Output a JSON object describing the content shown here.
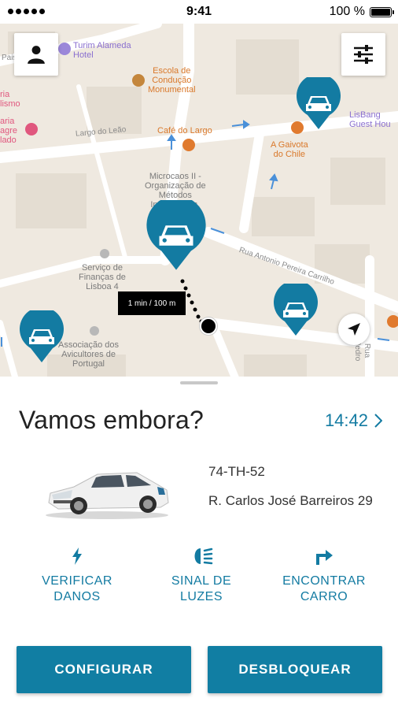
{
  "status_bar": {
    "time": "9:41",
    "battery": "100 %"
  },
  "map": {
    "labels": {
      "hotel": "Turim Alameda\nHotel",
      "school": "Escola de\nCondução\nMonumental",
      "street_leao": "Largo do Leão",
      "cafe": "Café do Largo",
      "gaivota": "A Gaivota\ndo Chile",
      "lisbang": "LisBang\nGuest Hou",
      "microcaos": "Microcaos II -\nOrganização de\nMétodos\nInformáticos,",
      "rua_antonio": "Rua Antonio Pereira Carrilho",
      "financas": "Serviço de\nFinanças de\nLisboa 4",
      "avicultores": "Associação dos\nAvicultores de\nPortugal",
      "left_edge_1": "ria\nlismo",
      "left_edge_2": "aria\nagre\nlado",
      "pais": "Pais",
      "right_edge": "Rua Pedro"
    },
    "eta_tooltip": "1 min / 100 m",
    "accent_color": "#137ba2"
  },
  "sheet": {
    "headline": "Vamos embora?",
    "time": "14:42",
    "plate": "74-TH-52",
    "address": "R. Carlos José Barreiros 29",
    "actions": [
      {
        "label": "VERIFICAR\nDANOS",
        "icon": "lightning-icon"
      },
      {
        "label": "SINAL DE\nLUZES",
        "icon": "headlight-icon"
      },
      {
        "label": "ENCONTRAR\nCARRO",
        "icon": "turn-right-arrow-icon"
      }
    ],
    "buttons": {
      "configure": "CONFIGURAR",
      "unlock": "DESBLOQUEAR"
    }
  }
}
